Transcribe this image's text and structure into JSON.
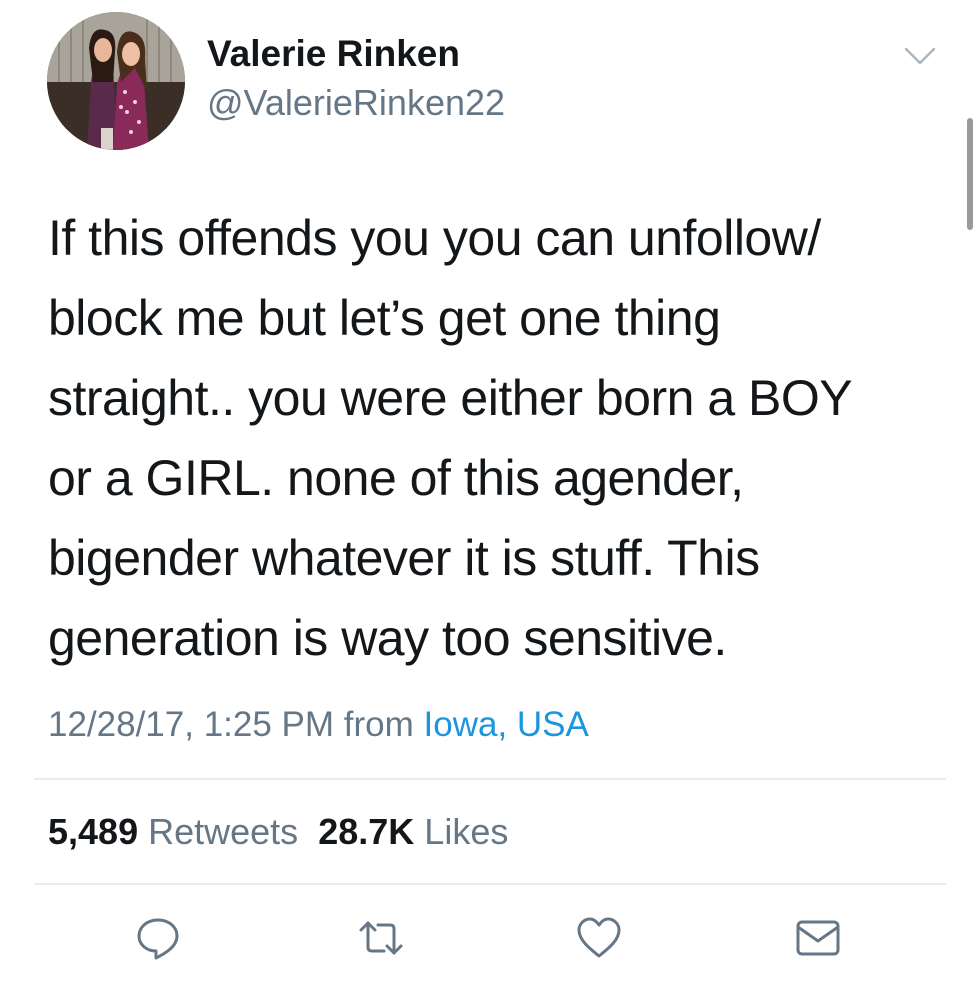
{
  "tweet": {
    "author": {
      "display_name": "Valerie Rinken",
      "handle": "@ValerieRinken22"
    },
    "text_lines": [
      "If this offends you you can unfollow/",
      "block me but let’s get one thing",
      "straight.. you were either born a BOY",
      "or a GIRL. none of this agender,",
      "bigender whatever it is stuff. This",
      "generation is way too sensitive."
    ],
    "timestamp": "12/28/17, 1:25 PM",
    "from_label": "from",
    "location": "Iowa, USA",
    "stats": {
      "retweets_count": "5,489",
      "retweets_label": "Retweets",
      "likes_count": "28.7K",
      "likes_label": "Likes"
    },
    "actions": [
      "reply-icon",
      "retweet-icon",
      "like-icon",
      "share-mail-icon"
    ]
  },
  "colors": {
    "text": "#14171a",
    "secondary": "#657786",
    "link": "#1b95e0",
    "divider": "#e6ecf0",
    "icon": "#657786"
  }
}
